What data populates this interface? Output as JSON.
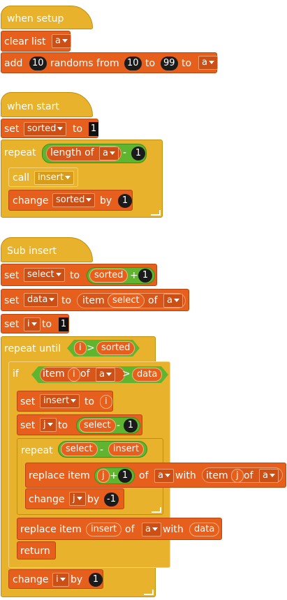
{
  "script1": {
    "hat": "when setup",
    "clear_list": "clear list",
    "clear_list_var": "a",
    "add": "add",
    "add_count": "10",
    "randoms_from": "randoms from",
    "from_value": "10",
    "to": "to",
    "to_value": "99",
    "to2": "to",
    "list_var": "a"
  },
  "script2": {
    "hat": "when start",
    "set": "set",
    "set_var": "sorted",
    "to": "to",
    "set_value": "1",
    "repeat": "repeat",
    "length_of": "length of",
    "length_var": "a",
    "minus": "-",
    "minus_value": "1",
    "call": "call",
    "call_target": "insert",
    "change": "change",
    "change_var": "sorted",
    "by": "by",
    "change_value": "1"
  },
  "script3": {
    "hat": "Sub insert",
    "set1": "set",
    "set1_var": "select",
    "set1_to": "to",
    "set1_reporter": "sorted",
    "plus": "+",
    "set1_add": "1",
    "set2": "set",
    "set2_var": "data",
    "set2_to": "to",
    "item": "item",
    "item_index": "select",
    "of": "of",
    "item_list": "a",
    "set3": "set",
    "set3_var": "i",
    "set3_to": "to",
    "set3_value": "1",
    "repeat_until": "repeat until",
    "cond_left": "i",
    "gt": ">",
    "cond_right": "sorted",
    "if": "if",
    "if_item": "item",
    "if_index": "i",
    "if_of": "of",
    "if_list": "a",
    "if_gt": ">",
    "if_right": "data",
    "set4": "set",
    "set4_var": "insert",
    "set4_to": "to",
    "set4_value": "i",
    "set5": "set",
    "set5_var": "j",
    "set5_to": "to",
    "set5_left": "select",
    "set5_minus": "-",
    "set5_value": "1",
    "repeat": "repeat",
    "rep_left": "select",
    "rep_minus": "-",
    "rep_right": "insert",
    "replace_item": "replace item",
    "rep_j": "j",
    "rep_plus": "+",
    "rep_one": "1",
    "rep_of": "of",
    "rep_list": "a",
    "with": "with",
    "with_item": "item",
    "with_j": "j",
    "with_of": "of",
    "with_list": "a",
    "change": "change",
    "change_var": "j",
    "by": "by",
    "change_value": "-1",
    "replace_item2": "replace item",
    "rep2_index": "insert",
    "rep2_of": "of",
    "rep2_list": "a",
    "with2": "with",
    "with2_value": "data",
    "return": "return",
    "change2": "change",
    "change2_var": "i",
    "by2": "by",
    "change2_value": "1"
  }
}
